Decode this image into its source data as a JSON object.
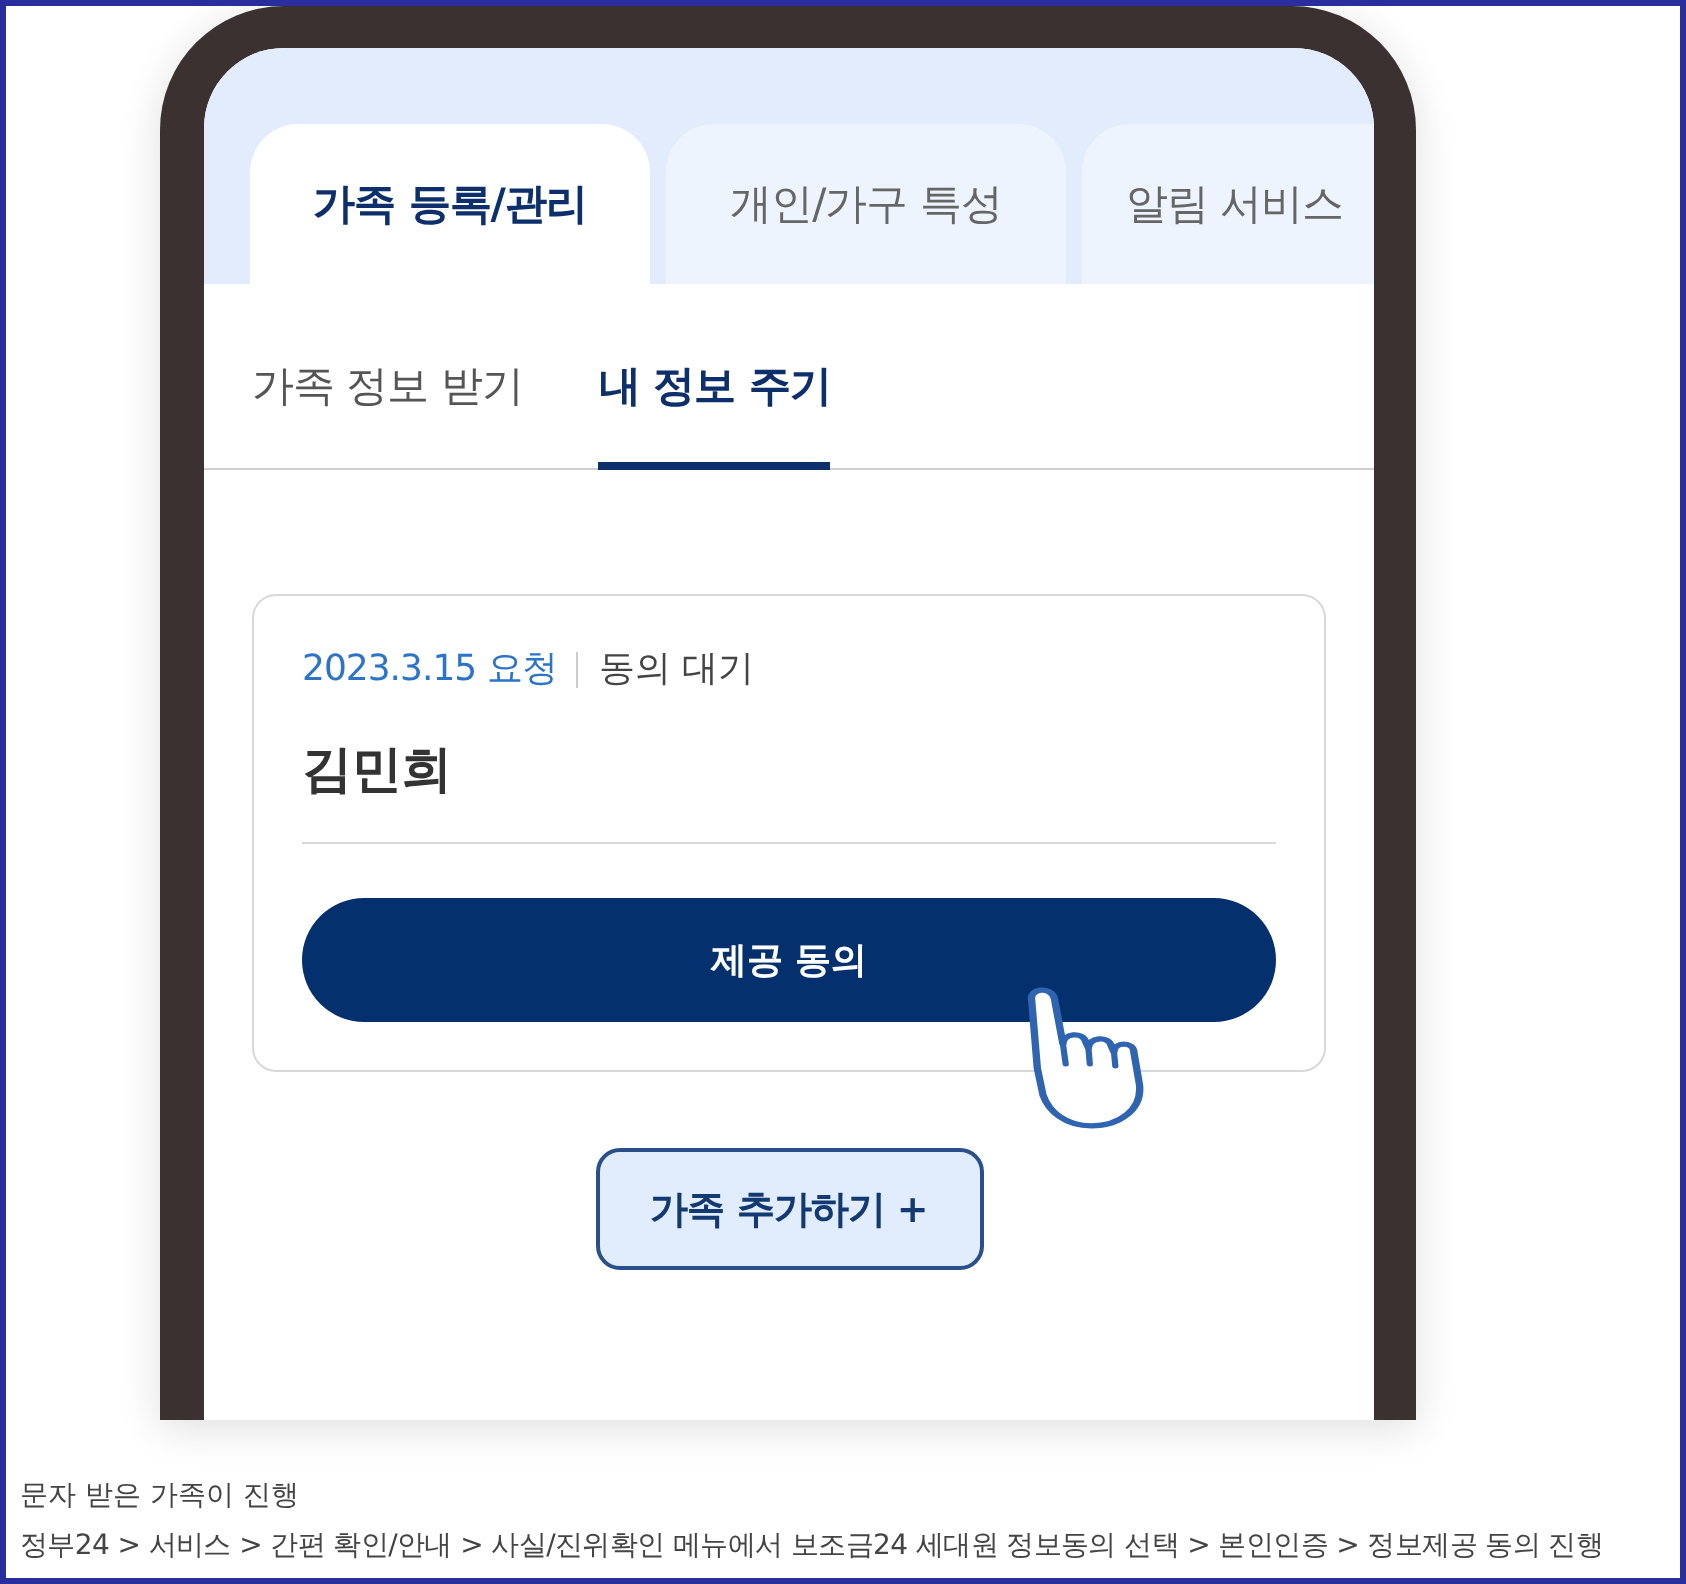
{
  "tabs": [
    {
      "label": "가족 등록/관리",
      "selected": true
    },
    {
      "label": "개인/가구 특성",
      "selected": false
    },
    {
      "label": "알림 서비스",
      "selected": false
    }
  ],
  "subtabs": [
    {
      "label": "가족 정보 받기",
      "selected": false
    },
    {
      "label": "내 정보 주기",
      "selected": true
    }
  ],
  "request_card": {
    "date": "2023.3.15 요청",
    "status": "동의 대기",
    "name": "김민희",
    "button": "제공 동의"
  },
  "add_button": "가족 추가하기 +",
  "caption": {
    "title": "문자 받은 가족이 진행",
    "path": "정부24 > 서비스 > 간편 확인/안내 > 사실/진위확인 메뉴에서 보조금24 세대원 정보동의 선택 > 본인인증 > 정보제공 동의 진행"
  }
}
